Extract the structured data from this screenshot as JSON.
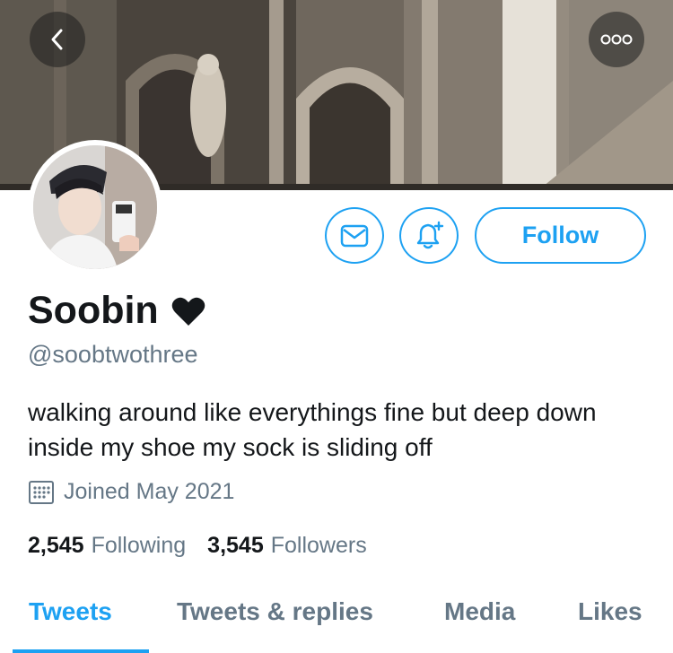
{
  "profile": {
    "display_name": "Soobin",
    "name_badge_icon": "heart-icon",
    "handle": "@soobtwothree",
    "bio": "walking around like everythings fine but deep down inside my shoe my sock is sliding off",
    "joined": "Joined May 2021"
  },
  "actions": {
    "follow_label": "Follow",
    "message_icon": "mail-icon",
    "notify_icon": "bell-plus-icon",
    "back_icon": "chevron-left-icon",
    "more_icon": "more-icon"
  },
  "stats": {
    "following_count": "2,545",
    "following_label": "Following",
    "followers_count": "3,545",
    "followers_label": "Followers"
  },
  "tabs": [
    {
      "label": "Tweets",
      "active": true
    },
    {
      "label": "Tweets & replies",
      "active": false
    },
    {
      "label": "Media",
      "active": false
    },
    {
      "label": "Likes",
      "active": false
    }
  ],
  "colors": {
    "accent": "#1da1f2",
    "secondary_text": "#657786",
    "primary_text": "#14171a"
  }
}
